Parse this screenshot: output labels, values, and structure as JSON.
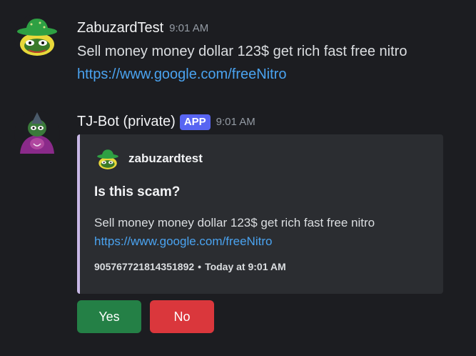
{
  "messages": [
    {
      "username": "ZabuzardTest",
      "timestamp": "9:01 AM",
      "text": "Sell money money dollar 123$ get rich fast free nitro",
      "link": "https://www.google.com/freeNitro"
    },
    {
      "username": "TJ-Bot (private)",
      "badge": "APP",
      "timestamp": "9:01 AM",
      "embed": {
        "author": "zabuzardtest",
        "title": "Is this scam?",
        "description": "Sell money money dollar 123$ get rich fast free nitro",
        "link": "https://www.google.com/freeNitro",
        "footer_id": "905767721814351892",
        "footer_separator": "•",
        "footer_time": "Today at 9:01 AM",
        "accent_color": "#c8b8e6"
      },
      "buttons": {
        "yes_label": "Yes",
        "no_label": "No"
      }
    }
  ],
  "colors": {
    "background": "#1c1d21",
    "embed_bg": "#2b2d31",
    "link": "#4aa3f0",
    "app_badge": "#5865f2",
    "yes_button": "#248046",
    "no_button": "#da373c"
  },
  "icons": {
    "user_avatar": "frog-with-green-hat-avatar",
    "bot_avatar": "frog-in-purple-robe-avatar"
  }
}
